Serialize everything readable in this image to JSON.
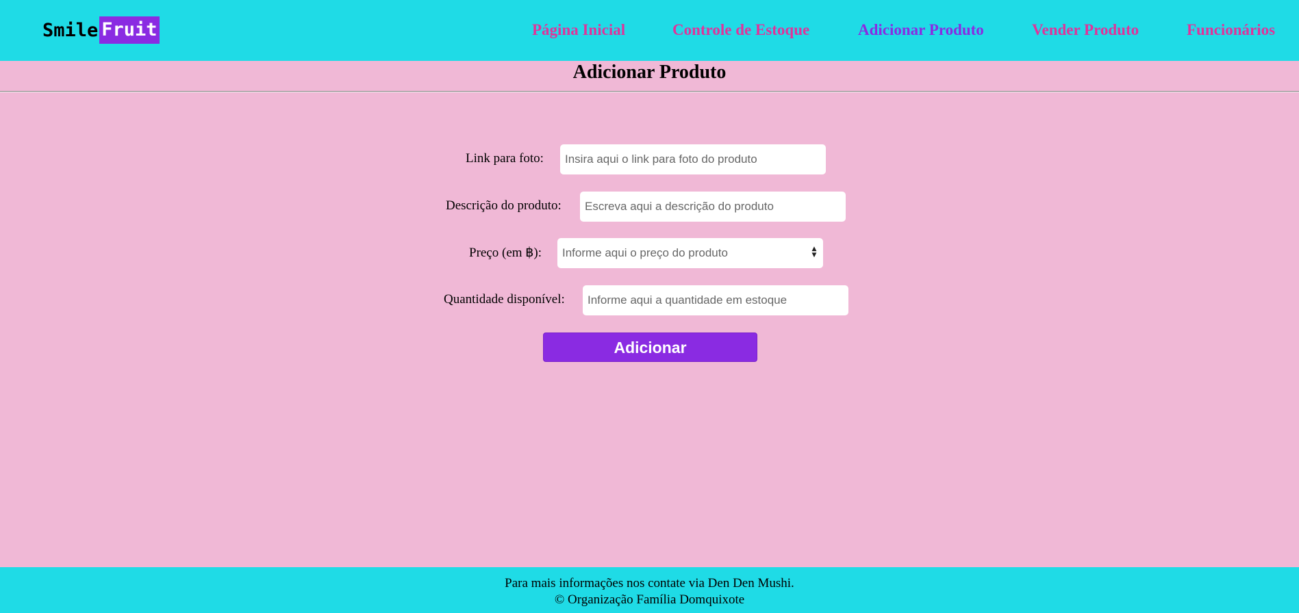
{
  "brand": {
    "name_part1": "Smile",
    "name_part2": "Fruit",
    "accent": "#8a2be2",
    "header_bg": "#1fdbe6",
    "page_bg": "#f0b8d6",
    "link_color": "#e0339a"
  },
  "nav": {
    "items": [
      {
        "label": "Página Inicial"
      },
      {
        "label": "Controle de Estoque"
      },
      {
        "label": "Adicionar Produto",
        "active": true
      },
      {
        "label": "Vender Produto"
      },
      {
        "label": "Funcionários"
      }
    ]
  },
  "main": {
    "title": "Adicionar Produto",
    "form": {
      "photo_link": {
        "label": "Link para foto:",
        "placeholder": "Insira aqui o link para foto do produto",
        "value": ""
      },
      "description": {
        "label": "Descrição do produto:",
        "placeholder": "Escreva aqui a descrição do produto",
        "value": ""
      },
      "price": {
        "label": "Preço (em ฿):",
        "placeholder": "Informe aqui o preço do produto",
        "value": ""
      },
      "quantity": {
        "label": "Quantidade disponível:",
        "placeholder": "Informe aqui a quantidade em estoque",
        "value": ""
      },
      "submit_label": "Adicionar"
    }
  },
  "footer": {
    "line1": "Para mais informações nos contate via Den Den Mushi.",
    "line2": "© Organização Família Domquixote"
  }
}
